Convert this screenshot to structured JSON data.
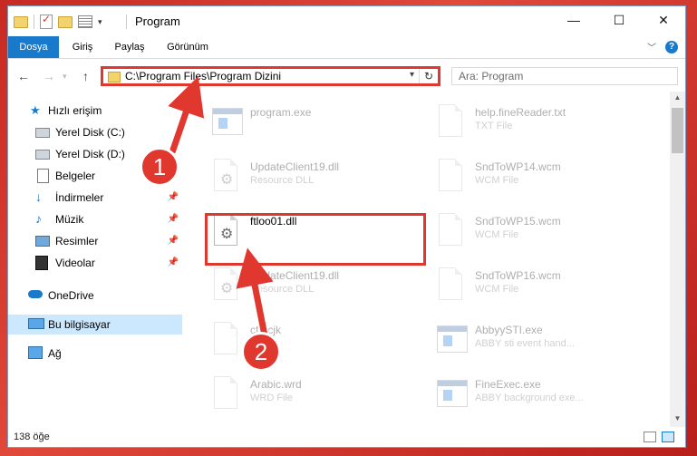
{
  "window": {
    "title": "Program",
    "controls": {
      "minimize": "—",
      "maximize": "☐",
      "close": "✕"
    }
  },
  "ribbon": {
    "tabs": [
      "Dosya",
      "Giriş",
      "Paylaş",
      "Görünüm"
    ],
    "active_tab": "Dosya",
    "help": "?"
  },
  "navigation": {
    "back": "←",
    "forward": "→",
    "up": "↑",
    "address": "C:\\Program Files\\Program Dizini",
    "refresh": "↻",
    "search_placeholder": "Ara: Program"
  },
  "sidebar": {
    "items": [
      {
        "label": "Hızlı erişim",
        "icon": "star-icon"
      },
      {
        "label": "Yerel Disk (C:)",
        "icon": "drive-icon"
      },
      {
        "label": "Yerel Disk (D:)",
        "icon": "drive-icon"
      },
      {
        "label": "Belgeler",
        "icon": "documents-icon"
      },
      {
        "label": "İndirmeler",
        "icon": "download-icon"
      },
      {
        "label": "Müzik",
        "icon": "music-icon"
      },
      {
        "label": "Resimler",
        "icon": "pictures-icon"
      },
      {
        "label": "Videolar",
        "icon": "video-icon"
      },
      {
        "label": "OneDrive",
        "icon": "cloud-icon"
      },
      {
        "label": "Bu bilgisayar",
        "icon": "computer-icon"
      },
      {
        "label": "Ağ",
        "icon": "network-icon"
      }
    ],
    "selected": "Bu bilgisayar"
  },
  "files": [
    {
      "name": "program.exe",
      "type": "",
      "icon": "app-icon"
    },
    {
      "name": "help.fineReader.txt",
      "type": "TXT File",
      "icon": "text-file-icon"
    },
    {
      "name": "UpdateClient19.dll",
      "type": "Resource DLL",
      "icon": "dll-icon"
    },
    {
      "name": "SndToWP14.wcm",
      "type": "WCM File",
      "icon": "file-icon"
    },
    {
      "name": "ftloo01.dll",
      "type": "",
      "icon": "dll-icon"
    },
    {
      "name": "SndToWP15.wcm",
      "type": "WCM File",
      "icon": "file-icon"
    },
    {
      "name": "UpdateClient19.dll",
      "type": "Resource DLL",
      "icon": "dll-icon"
    },
    {
      "name": "SndToWP16.wcm",
      "type": "WCM File",
      "icon": "file-icon"
    },
    {
      "name": "cfg.cjk",
      "type": "File",
      "icon": "file-icon"
    },
    {
      "name": "AbbyySTI.exe",
      "type": "ABBY sti event hand...",
      "icon": "app-icon"
    },
    {
      "name": "Arabic.wrd",
      "type": "WRD File",
      "icon": "file-icon"
    },
    {
      "name": "FineExec.exe",
      "type": "ABBY background exe...",
      "icon": "app-icon"
    }
  ],
  "status": {
    "item_count": "138 öğe"
  },
  "annotations": {
    "step1": "1",
    "step2": "2"
  },
  "colors": {
    "accent": "#1979ca",
    "highlight": "#e0372f",
    "selection": "#cce8ff"
  }
}
